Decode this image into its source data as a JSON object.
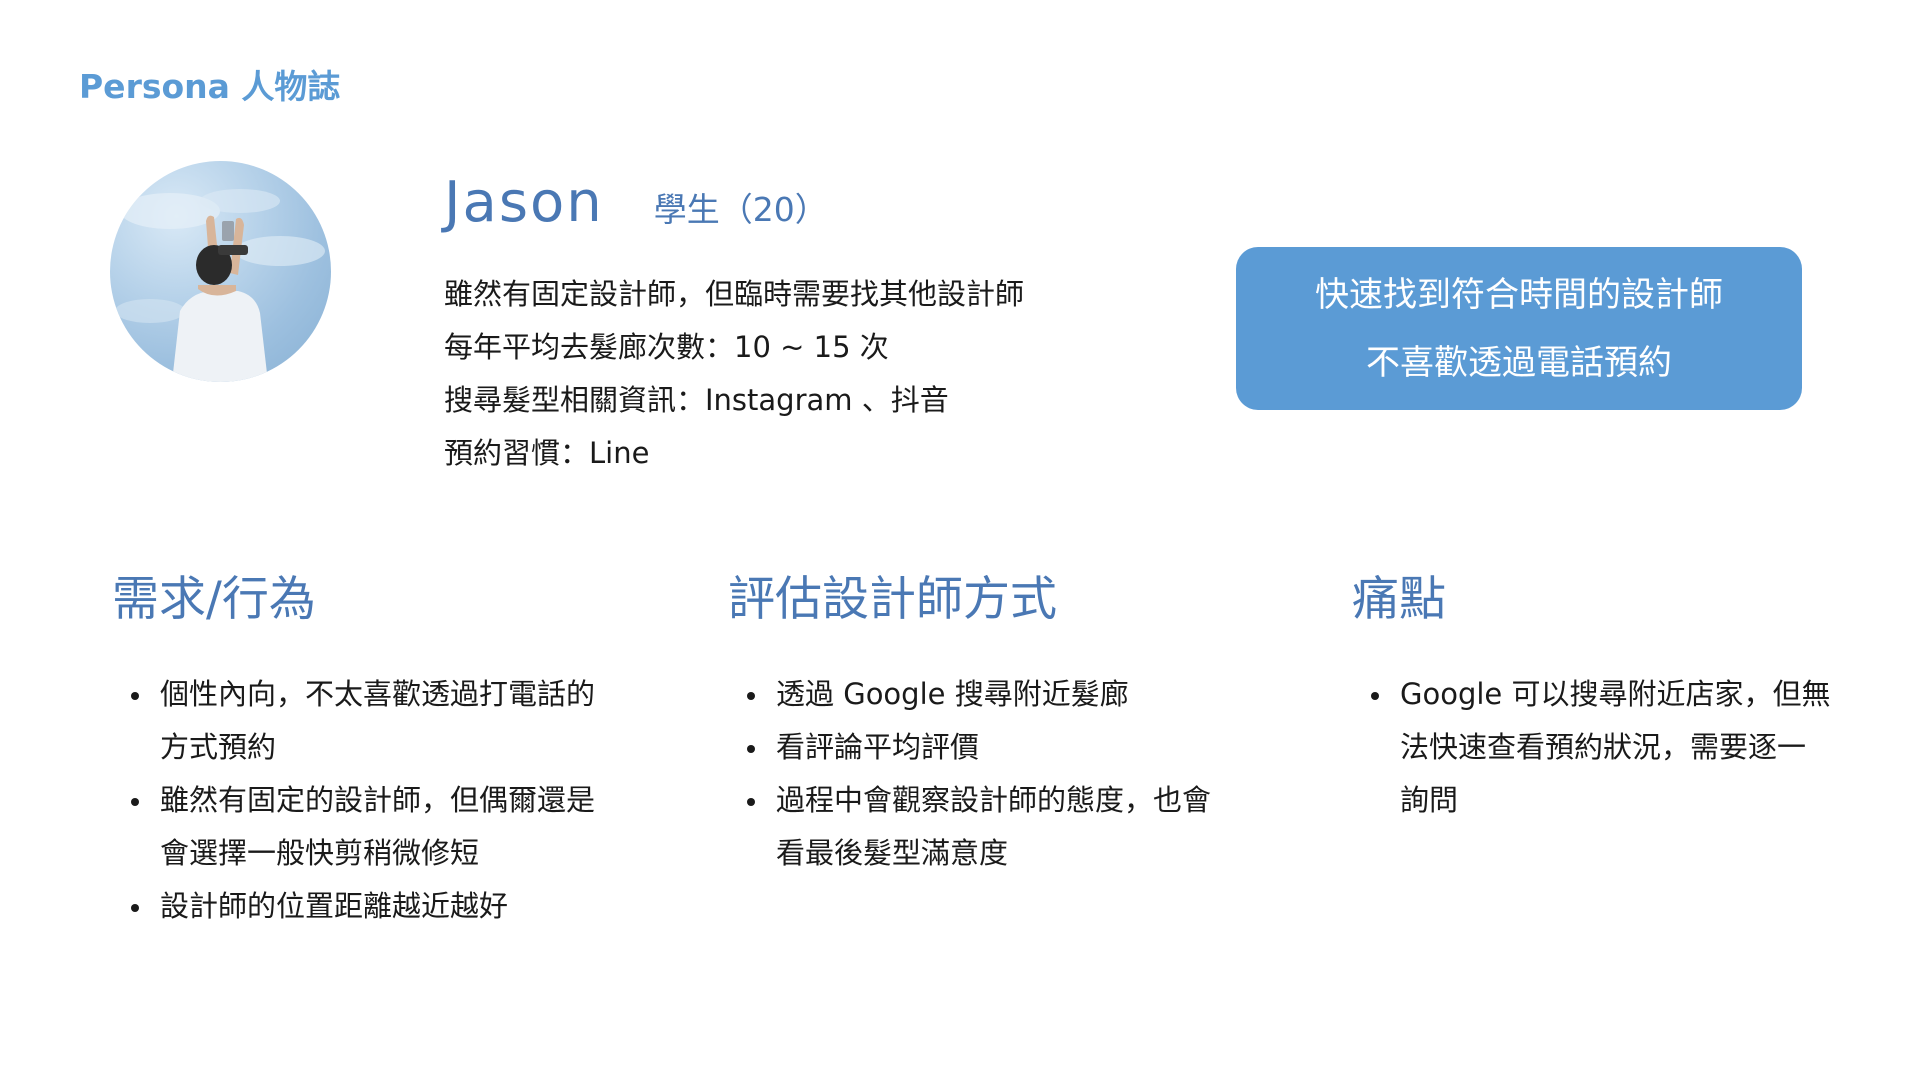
{
  "page_label": "Persona 人物誌",
  "persona": {
    "name": "Jason",
    "role": "學生（20）",
    "facts": [
      "雖然有固定設計師，但臨時需要找其他設計師",
      "每年平均去髮廊次數：10 ~ 15 次",
      "搜尋髮型相關資訊：Instagram 、抖音",
      "預約習慣：Line"
    ]
  },
  "goal_card": {
    "lines": [
      "快速找到符合時間的設計師",
      "不喜歡透過電話預約"
    ]
  },
  "sections": [
    {
      "title": "需求/行為",
      "items": [
        "個性內向，不太喜歡透過打電話的方式預約",
        "雖然有固定的設計師，但偶爾還是會選擇一般快剪稍微修短",
        "設計師的位置距離越近越好"
      ]
    },
    {
      "title": "評估設計師方式",
      "items": [
        "透過 Google 搜尋附近髮廊",
        "看評論平均評價",
        "過程中會觀察設計師的態度，也會看最後髮型滿意度"
      ]
    },
    {
      "title": "痛點",
      "items": [
        " Google 可以搜尋附近店家，但無法快速查看預約狀況，需要逐一詢問"
      ]
    }
  ]
}
